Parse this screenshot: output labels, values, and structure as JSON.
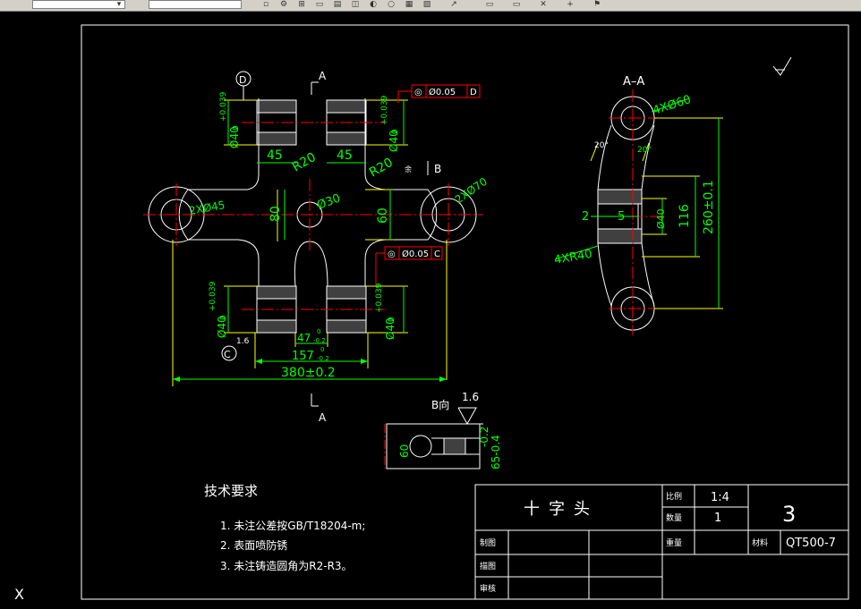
{
  "toolbar": {
    "layer_combo": "",
    "style_combo": ""
  },
  "drawing": {
    "section_top_label": "A",
    "section_bottom_label": "A",
    "section_view_title": "A–A",
    "view_b_label": "B向",
    "detail_marker_b": "B",
    "datum_d": "D",
    "datum_c": "C",
    "tolerance_d_symbol": "◎",
    "tolerance_d_value": "Ø0.05",
    "tolerance_d_ref": "D",
    "tolerance_c_symbol": "◎",
    "tolerance_c_value": "Ø0.05",
    "tolerance_c_ref": "C",
    "dims": {
      "upper_left_dia": "Ø40",
      "upper_left_tol": "+0.039",
      "upper_left_tol_lower": "0",
      "upper_right_dia": "Ø40",
      "upper_right_tol": "+0.039",
      "upper_right_tol_lower": "0",
      "lower_left_dia": "Ø40",
      "lower_left_tol": "+0.039",
      "lower_left_tol_lower": "0",
      "lower_right_dia": "Ø40",
      "lower_right_tol": "+0.039",
      "lower_right_tol_lower": "0",
      "width_45_left": "45",
      "width_45_right": "45",
      "r20_left": "R20",
      "r20_right": "R20",
      "dim_80": "80",
      "dim_60": "60",
      "center_hole": "Ø30",
      "left_hole": "2XØ45",
      "right_hole": "2XØ70",
      "dim_47": "47",
      "dim_47_tol_upper": "0",
      "dim_47_tol_lower": "-0.2",
      "dim_157": "157",
      "dim_157_tol_upper": "0",
      "dim_157_tol_lower": "-0.2",
      "dim_380": "380±0.2",
      "side_4x60": "4XØ60",
      "side_angle_20a": "20°",
      "side_angle_20b": "20°",
      "side_dim_2": "2",
      "side_dim_5": "5",
      "side_dia_40": "Ø40",
      "side_116": "116",
      "side_260": "260±0.1",
      "side_4xr40": "4XR40",
      "roughness_small": "1.6",
      "view_b_roughness": "1.6",
      "view_b_60": "60",
      "view_b_neg02": "-0.2",
      "view_b_65": "65-0.4",
      "gen_name_small": "余",
      "b_small_label": "余"
    },
    "notes_title": "技术要求",
    "notes": [
      "1. 未注公差按GB/T18204-m;",
      "2. 表面喷防锈",
      "3. 未注铸造圆角为R2-R3。"
    ],
    "title_block": {
      "part_name": "十字头",
      "scale_label": "比例",
      "scale_value": "1:4",
      "qty_label": "数量",
      "qty_value": "1",
      "sheet_no": "3",
      "draw_label": "制图",
      "weight_label": "重量",
      "material_label": "材料",
      "material_value": "QT500-7",
      "check_label": "描图",
      "approve_label": "审核"
    },
    "ucs_label": "X"
  },
  "colors": {
    "background": "#000000",
    "outline": "#ffffff",
    "dimension": "#00ff00",
    "centerline": "#ff0000",
    "extension": "#ffff00",
    "toolbar": "#d4d0c8"
  }
}
